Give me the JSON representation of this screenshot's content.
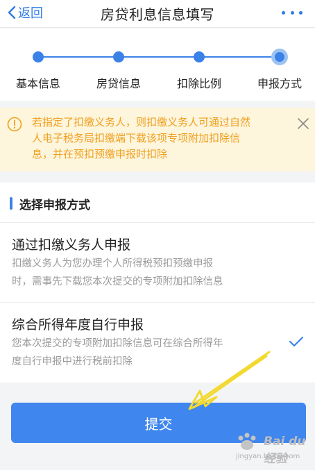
{
  "navbar": {
    "back_label": "返回",
    "title": "房贷利息信息填写",
    "back_icon": "chevron-left-icon",
    "more_icon": "more-dots-icon"
  },
  "steps": {
    "items": [
      {
        "label": "基本信息",
        "state": "done"
      },
      {
        "label": "房贷信息",
        "state": "done"
      },
      {
        "label": "扣除比例",
        "state": "done"
      },
      {
        "label": "申报方式",
        "state": "current"
      }
    ],
    "current_index": 3
  },
  "notice": {
    "lines": [
      "若指定了扣缴义务人，则扣缴义务人可通过自然",
      "人电子税务局扣缴端下载该项专项附加扣除信",
      "息，并在预扣预缴申报时扣除"
    ],
    "icon": "warning-circle-icon",
    "close_icon": "close-icon"
  },
  "section": {
    "title": "选择申报方式"
  },
  "options": [
    {
      "title": "通过扣缴义务人申报",
      "desc_lines": [
        "扣缴义务人为您办理个人所得税预扣预缴申报",
        "时，需事先下载您本次提交的专项附加扣除信息"
      ],
      "selected": false
    },
    {
      "title": "综合所得年度自行申报",
      "desc_lines": [
        "您本次提交的专项附加扣除信息可在综合所得年",
        "度自行申报中进行税前扣除"
      ],
      "selected": true
    }
  ],
  "submit_label": "提交",
  "watermark": {
    "brand": "Bai du 经验",
    "sub": "jingyan.baidu.com"
  },
  "colors": {
    "accent": "#3f86ee",
    "notice_bg": "#fdf5dc",
    "notice_text": "#f0a020",
    "annotation_arrow": "#f2d930"
  }
}
